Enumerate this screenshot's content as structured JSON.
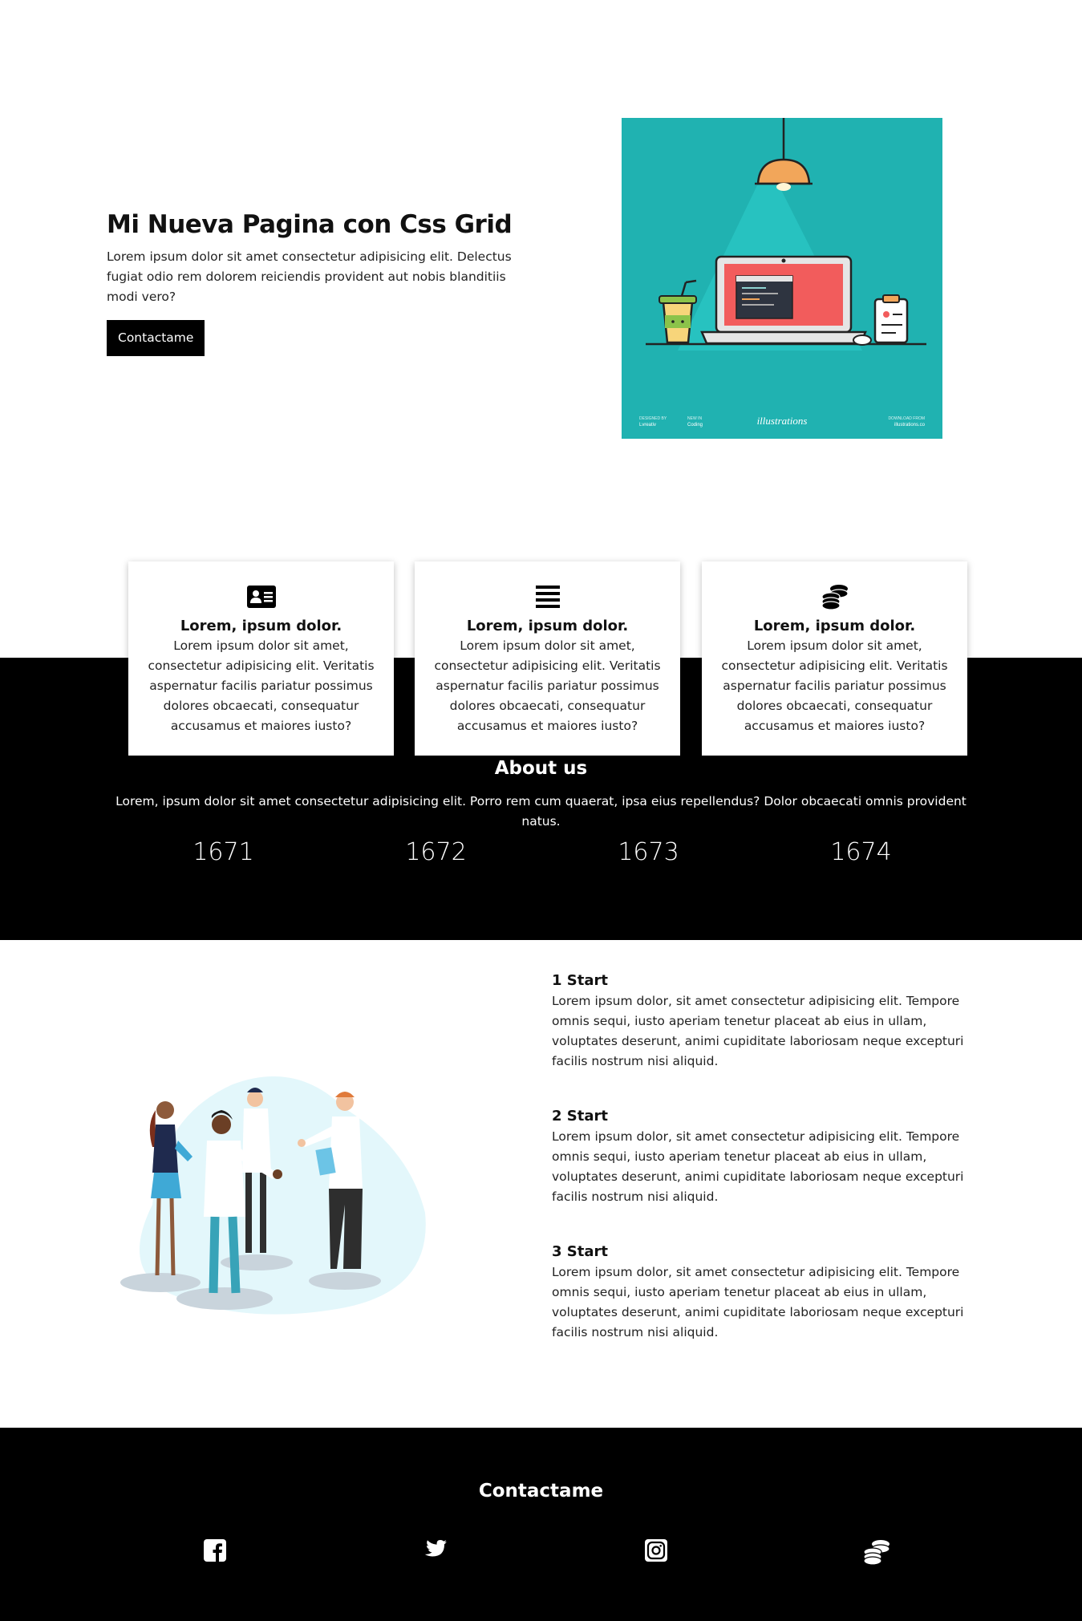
{
  "hero": {
    "title": "Mi Nueva Pagina con Css Grid",
    "description": "Lorem ipsum dolor sit amet consectetur adipisicing elit. Delectus fugiat odio rem dolorem reiciendis provident aut nobis blanditiis modi vero?",
    "button_label": "Contactame",
    "illustration": {
      "name": "laptop-desk-illustration",
      "footer_labels": [
        "DESIGNED BY",
        "Lvreativ",
        "NEW IN",
        "Coding",
        "illustrations",
        "DOWNLOAD FROM",
        "illustrations.co"
      ],
      "bg_color": "#20b2b1"
    }
  },
  "cards": [
    {
      "icon": "id-card-icon",
      "title": "Lorem, ipsum dolor.",
      "text": "Lorem ipsum dolor sit amet, consectetur adipisicing elit. Veritatis aspernatur facilis pariatur possimus dolores obcaecati, consequatur accusamus et maiores iusto?"
    },
    {
      "icon": "menu-lines-icon",
      "title": "Lorem, ipsum dolor.",
      "text": "Lorem ipsum dolor sit amet, consectetur adipisicing elit. Veritatis aspernatur facilis pariatur possimus dolores obcaecati, consequatur accusamus et maiores iusto?"
    },
    {
      "icon": "coins-icon",
      "title": "Lorem, ipsum dolor.",
      "text": "Lorem ipsum dolor sit amet, consectetur adipisicing elit. Veritatis aspernatur facilis pariatur possimus dolores obcaecati, consequatur accusamus et maiores iusto?"
    }
  ],
  "about": {
    "title": "About us",
    "text": "Lorem, ipsum dolor sit amet consectetur adipisicing elit. Porro rem cum quaerat, ipsa eius repellendus? Dolor obcaecati omnis provident natus.",
    "stats": [
      "1671",
      "1672",
      "1673",
      "1674"
    ]
  },
  "steps": [
    {
      "title": "1 Start",
      "text": "Lorem ipsum dolor, sit amet consectetur adipisicing elit. Tempore omnis sequi, iusto aperiam tenetur placeat ab eius in ullam, voluptates deserunt, animi cupiditate laboriosam neque excepturi facilis nostrum nisi aliquid."
    },
    {
      "title": "2 Start",
      "text": "Lorem ipsum dolor, sit amet consectetur adipisicing elit. Tempore omnis sequi, iusto aperiam tenetur placeat ab eius in ullam, voluptates deserunt, animi cupiditate laboriosam neque excepturi facilis nostrum nisi aliquid."
    },
    {
      "title": "3 Start",
      "text": "Lorem ipsum dolor, sit amet consectetur adipisicing elit. Tempore omnis sequi, iusto aperiam tenetur placeat ab eius in ullam, voluptates deserunt, animi cupiditate laboriosam neque excepturi facilis nostrum nisi aliquid."
    }
  ],
  "footer": {
    "title": "Contactame",
    "socials": [
      "facebook-icon",
      "twitter-icon",
      "instagram-icon",
      "coins-icon"
    ]
  },
  "colors": {
    "dark": "#000000",
    "light": "#ffffff",
    "teal": "#20b2b1"
  }
}
